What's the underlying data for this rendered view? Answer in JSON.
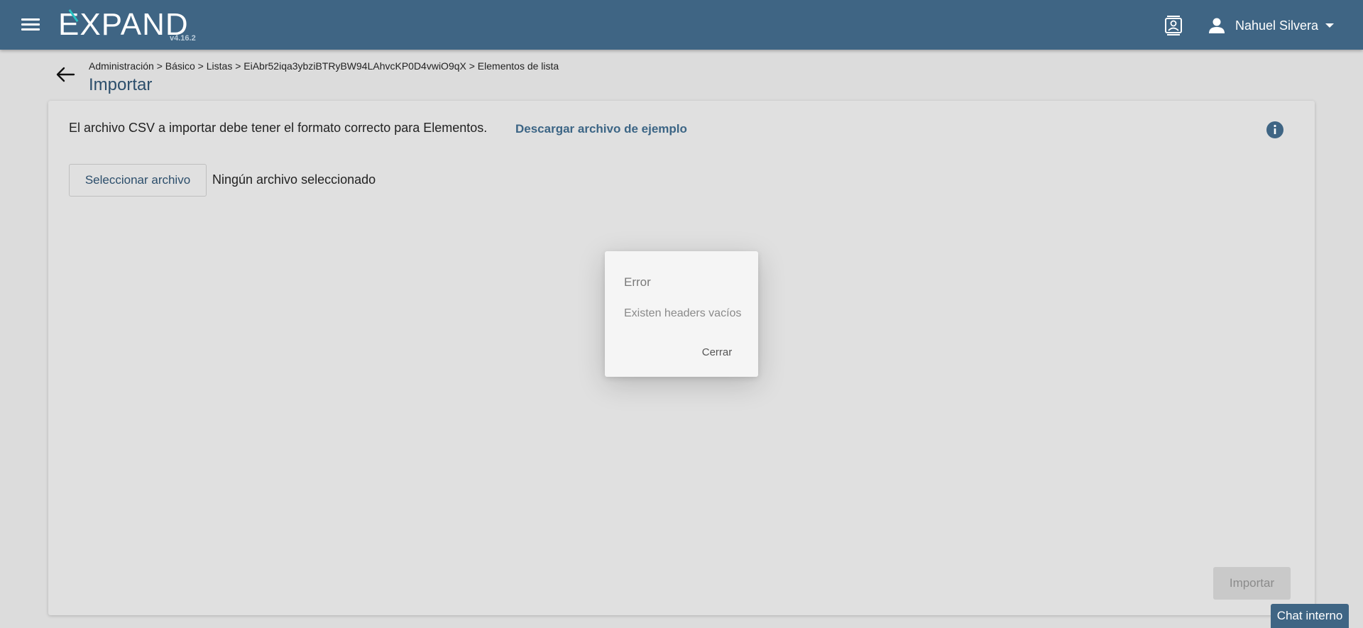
{
  "header": {
    "logo_text": "EXPAND",
    "version": "v4.16.2",
    "user_name": "Nahuel Silvera",
    "icons": {
      "menu": "hamburger-menu-icon",
      "contacts": "contacts-card-icon",
      "user": "person-icon",
      "caret": "caret-down-icon"
    }
  },
  "breadcrumb": "Administración > Básico > Listas > EiAbr52iqa3ybziBTRyBW94LAhvcKP0D4vwiO9qX > Elementos de lista",
  "page_title": "Importar",
  "card": {
    "description": "El archivo CSV a importar debe tener el formato correcto para Elementos.",
    "download_link": "Descargar archivo de ejemplo",
    "select_file_label": "Seleccionar archivo",
    "file_status": "Ningún archivo seleccionado",
    "import_label": "Importar"
  },
  "dialog": {
    "title": "Error",
    "message": "Existen headers vacíos",
    "close_label": "Cerrar"
  },
  "chat": {
    "label": "Chat interno"
  },
  "colors": {
    "header_bg": "#3f6584",
    "link": "#3c6585",
    "title": "#2c4e6b",
    "page_bg": "#dcdcdc"
  }
}
